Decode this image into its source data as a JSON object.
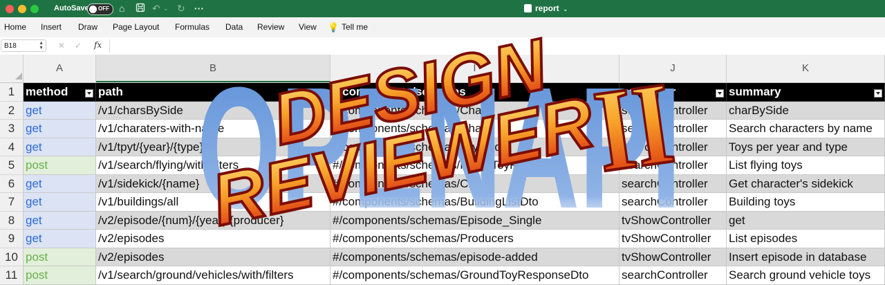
{
  "window": {
    "autosave_label": "AutoSave",
    "autosave_state": "OFF",
    "doc_title": "report",
    "toolbar_icons": [
      "home-icon",
      "save-icon",
      "undo-icon",
      "redo-icon",
      "more-icon"
    ]
  },
  "ribbon": {
    "tabs": [
      "Home",
      "Insert",
      "Draw",
      "Page Layout",
      "Formulas",
      "Data",
      "Review",
      "View",
      "Tell me"
    ]
  },
  "formula_bar": {
    "name_box": "B18",
    "fx_label": "fx",
    "content": ""
  },
  "columns": [
    "A",
    "B",
    "I",
    "J",
    "K"
  ],
  "row_numbers": [
    "1",
    "2",
    "3",
    "4",
    "5",
    "6",
    "7",
    "8",
    "9",
    "10",
    "11"
  ],
  "header_row": [
    "method",
    "path",
    "#/components/schemas",
    "controller",
    "summary"
  ],
  "rows": [
    {
      "method": "get",
      "path": "/v1/charsBySide",
      "schema": "#/components/schemas/Char",
      "controller": "searchController",
      "summary": "charBySide"
    },
    {
      "method": "get",
      "path": "/v1/charaters-with-name",
      "schema": "#/components/schemas/Char",
      "controller": "searchController",
      "summary": "Search characters by name"
    },
    {
      "method": "get",
      "path": "/v1/tpyt/{year}/{type}",
      "schema": "#/components/schemas/ToyModel",
      "controller": "searchController",
      "summary": "Toys per year and type"
    },
    {
      "method": "post",
      "path": "/v1/search/flying/with/filters",
      "schema": "#/components/schemas/FlyingToyResponse",
      "controller": "searchController",
      "summary": "List flying toys"
    },
    {
      "method": "get",
      "path": "/v1/sidekick/{name}",
      "schema": "#/components/schemas/Char",
      "controller": "searchController",
      "summary": "Get character's sidekick"
    },
    {
      "method": "get",
      "path": "/v1/buildings/all",
      "schema": "#/components/schemas/BuildingListDto",
      "controller": "searchController",
      "summary": "Building toys"
    },
    {
      "method": "get",
      "path": "/v2/episode/{num}/{year}/{producer}",
      "schema": "#/components/schemas/Episode_Single",
      "controller": "tvShowController",
      "summary": "get"
    },
    {
      "method": "get",
      "path": "/v2/episodes",
      "schema": "#/components/schemas/Producers",
      "controller": "tvShowController",
      "summary": "List episodes"
    },
    {
      "method": "post",
      "path": "/v2/episodes",
      "schema": "#/components/schemas/episode-added",
      "controller": "tvShowController",
      "summary": "Insert episode in database"
    },
    {
      "method": "post",
      "path": "/v1/search/ground/vehicles/with/filters",
      "schema": "#/components/schemas/GroundToyResponseDto",
      "controller": "searchController",
      "summary": "Search ground vehicle toys"
    }
  ],
  "logo": {
    "back_text": "OPENAPI",
    "line1": "DESIGN",
    "line2": "REVIEWER",
    "numeral": "II"
  },
  "colors": {
    "titlebar": "#1f7244",
    "get_text": "#2f6bd4",
    "post_text": "#6ab04c",
    "logo_blue": "#5b8fd8",
    "logo_red": "#d81e0e",
    "logo_orange": "#f7a128"
  }
}
